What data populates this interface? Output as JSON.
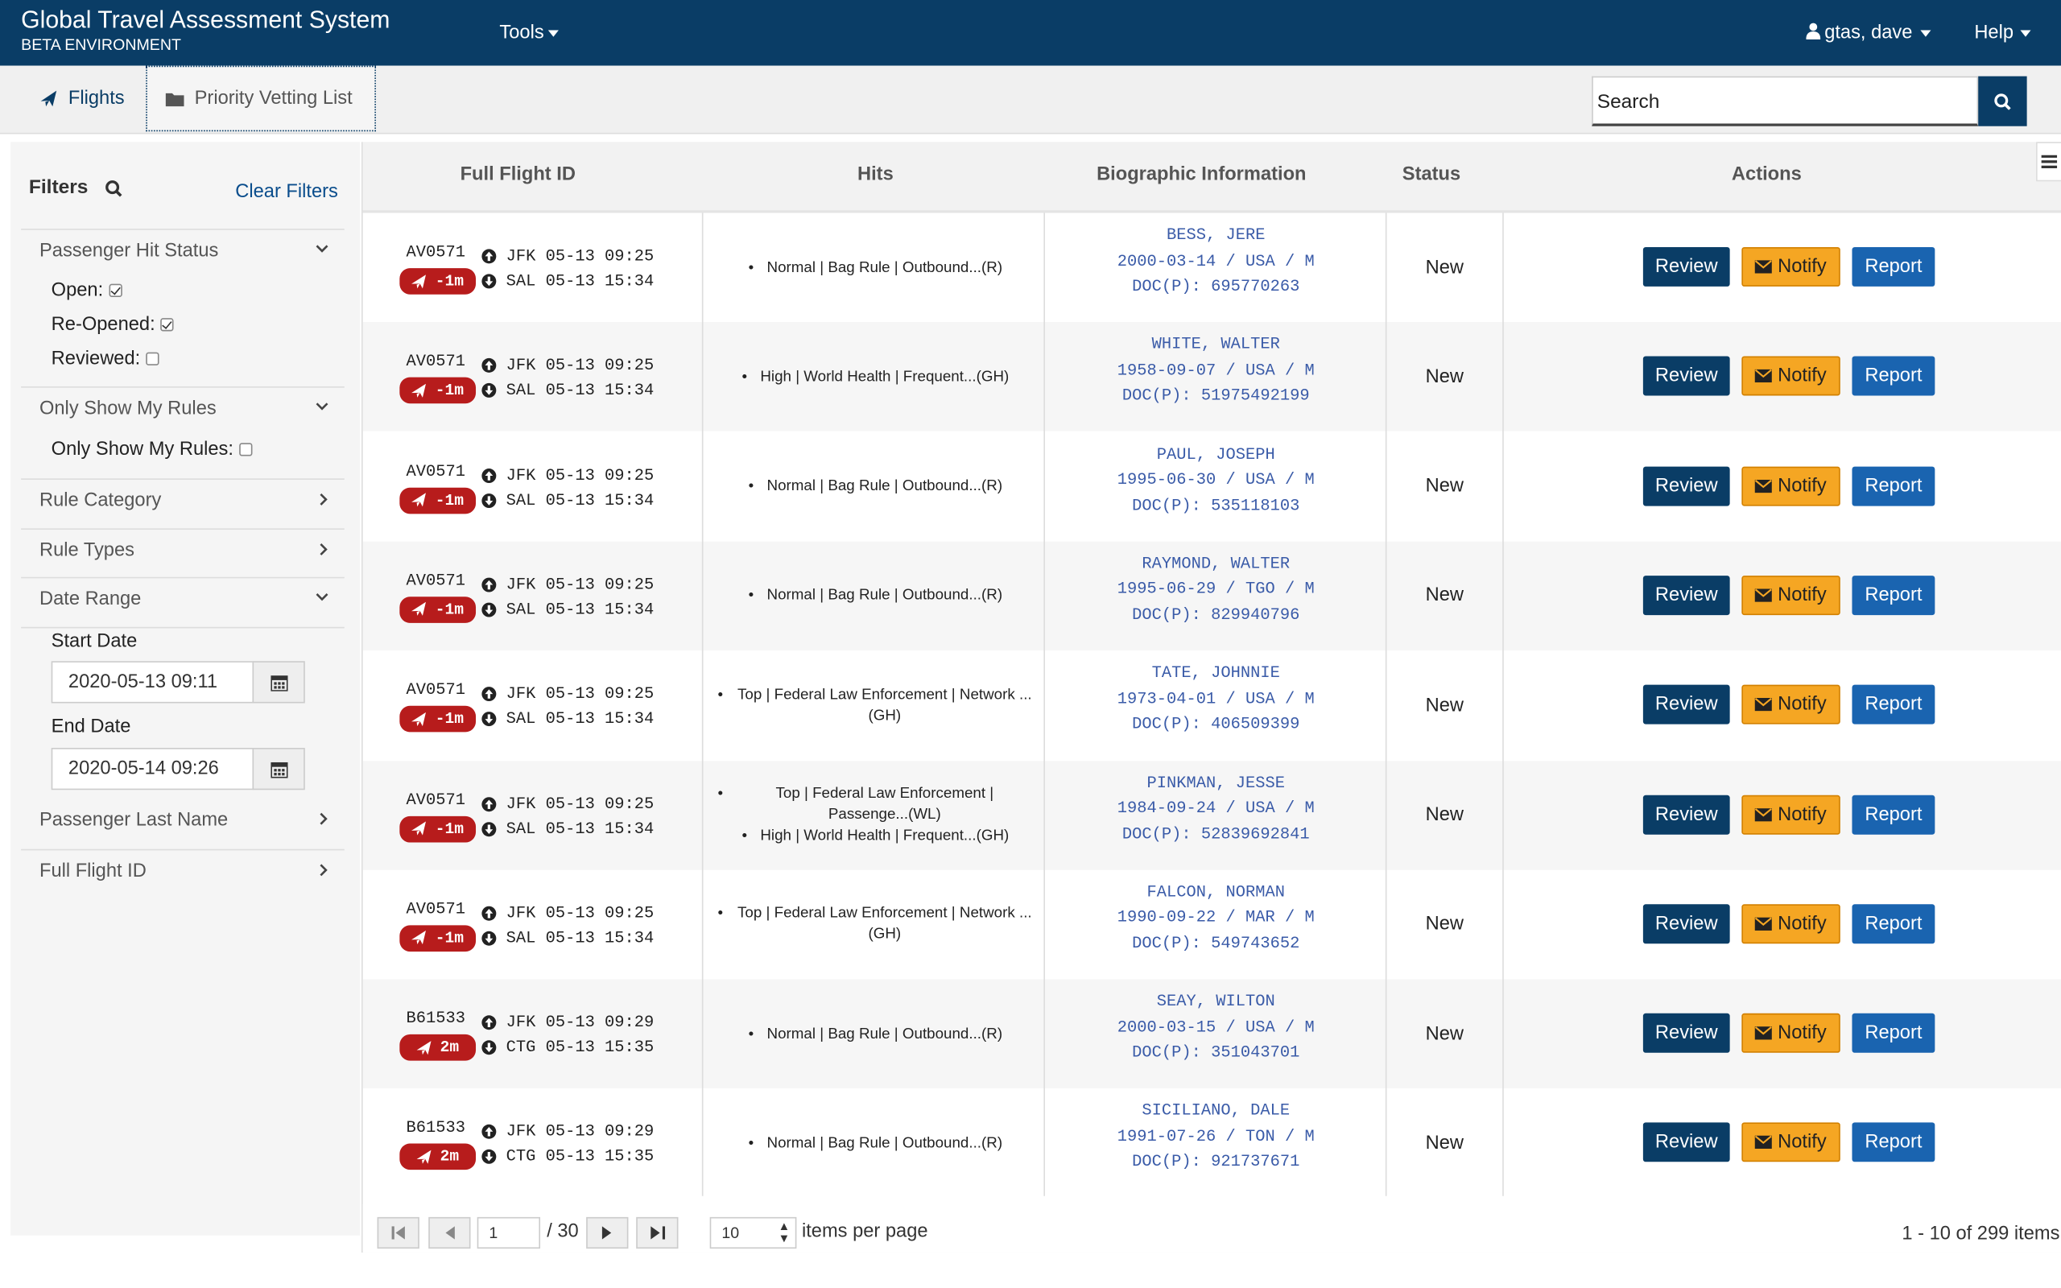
{
  "header": {
    "title": "Global Travel Assessment System",
    "subtitle": "BETA ENVIRONMENT",
    "tools": "Tools",
    "user": "gtas, dave",
    "help": "Help"
  },
  "tabs": [
    {
      "label": "Flights",
      "icon": "plane-icon"
    },
    {
      "label": "Priority Vetting List",
      "icon": "folder-icon"
    }
  ],
  "search": {
    "placeholder": "Search"
  },
  "filters": {
    "title": "Filters",
    "clear": "Clear Filters",
    "sections": {
      "hit_status": "Passenger Hit Status",
      "my_rules": "Only Show My Rules",
      "rule_category": "Rule Category",
      "rule_types": "Rule Types",
      "date_range": "Date Range",
      "last_name": "Passenger Last Name",
      "flight_id": "Full Flight ID"
    },
    "options": {
      "open": "Open:",
      "reopened": "Re-Opened:",
      "reviewed": "Reviewed:",
      "only_my_rules": "Only Show My Rules:"
    },
    "checked": {
      "open": true,
      "reopened": true,
      "reviewed": false,
      "only_my_rules": false
    },
    "start_label": "Start Date",
    "start_value": "2020-05-13 09:11",
    "end_label": "End Date",
    "end_value": "2020-05-14 09:26"
  },
  "grid": {
    "columns": [
      "Full Flight ID",
      "Hits",
      "Biographic Information",
      "Status",
      "Actions"
    ],
    "actions": {
      "review": "Review",
      "notify": "Notify",
      "report": "Report"
    },
    "rows": [
      {
        "flight": "AV0571",
        "badge": "-1m",
        "dep": "JFK 05-13 09:25",
        "arr": "SAL 05-13 15:34",
        "hits": [
          "Normal | Bag Rule | Outbound...(R)"
        ],
        "name": "BESS, JERE",
        "bio": "2000-03-14 / USA / M",
        "doc": "DOC(P): 695770263",
        "status": "New"
      },
      {
        "flight": "AV0571",
        "badge": "-1m",
        "dep": "JFK 05-13 09:25",
        "arr": "SAL 05-13 15:34",
        "hits": [
          "High | World Health | Frequent...(GH)"
        ],
        "name": "WHITE, WALTER",
        "bio": "1958-09-07 / USA / M",
        "doc": "DOC(P): 51975492199",
        "status": "New"
      },
      {
        "flight": "AV0571",
        "badge": "-1m",
        "dep": "JFK 05-13 09:25",
        "arr": "SAL 05-13 15:34",
        "hits": [
          "Normal | Bag Rule | Outbound...(R)"
        ],
        "name": "PAUL, JOSEPH",
        "bio": "1995-06-30 / USA / M",
        "doc": "DOC(P): 535118103",
        "status": "New"
      },
      {
        "flight": "AV0571",
        "badge": "-1m",
        "dep": "JFK 05-13 09:25",
        "arr": "SAL 05-13 15:34",
        "hits": [
          "Normal | Bag Rule | Outbound...(R)"
        ],
        "name": "RAYMOND, WALTER",
        "bio": "1995-06-29 / TGO / M",
        "doc": "DOC(P): 829940796",
        "status": "New"
      },
      {
        "flight": "AV0571",
        "badge": "-1m",
        "dep": "JFK 05-13 09:25",
        "arr": "SAL 05-13 15:34",
        "hits": [
          "Top | Federal Law Enforcement | Network ...(GH)"
        ],
        "name": "TATE, JOHNNIE",
        "bio": "1973-04-01 / USA / M",
        "doc": "DOC(P): 406509399",
        "status": "New"
      },
      {
        "flight": "AV0571",
        "badge": "-1m",
        "dep": "JFK 05-13 09:25",
        "arr": "SAL 05-13 15:34",
        "hits": [
          "Top | Federal Law Enforcement | Passenge...(WL)",
          "High | World Health | Frequent...(GH)"
        ],
        "name": "PINKMAN, JESSE",
        "bio": "1984-09-24 / USA / M",
        "doc": "DOC(P): 52839692841",
        "status": "New"
      },
      {
        "flight": "AV0571",
        "badge": "-1m",
        "dep": "JFK 05-13 09:25",
        "arr": "SAL 05-13 15:34",
        "hits": [
          "Top | Federal Law Enforcement | Network ...(GH)"
        ],
        "name": "FALCON, NORMAN",
        "bio": "1990-09-22 / MAR / M",
        "doc": "DOC(P): 549743652",
        "status": "New"
      },
      {
        "flight": "B61533",
        "badge": "2m",
        "dep": "JFK 05-13 09:29",
        "arr": "CTG 05-13 15:35",
        "hits": [
          "Normal | Bag Rule | Outbound...(R)"
        ],
        "name": "SEAY, WILTON",
        "bio": "2000-03-15 / USA / M",
        "doc": "DOC(P): 351043701",
        "status": "New"
      },
      {
        "flight": "B61533",
        "badge": "2m",
        "dep": "JFK 05-13 09:29",
        "arr": "CTG 05-13 15:35",
        "hits": [
          "Normal | Bag Rule | Outbound...(R)"
        ],
        "name": "SICILIANO, DALE",
        "bio": "1991-07-26 / TON / M",
        "doc": "DOC(P): 921737671",
        "status": "New"
      }
    ]
  },
  "pager": {
    "page": "1",
    "total_pages": "/ 30",
    "page_size": "10",
    "items_label": "items per page",
    "info": "1 - 10 of 299 items"
  },
  "colors": {
    "navy": "#0a3d66",
    "notify": "#f5a623",
    "report": "#1a64b0",
    "badge": "#b71c1c",
    "bio_text": "#3a5ba8"
  }
}
